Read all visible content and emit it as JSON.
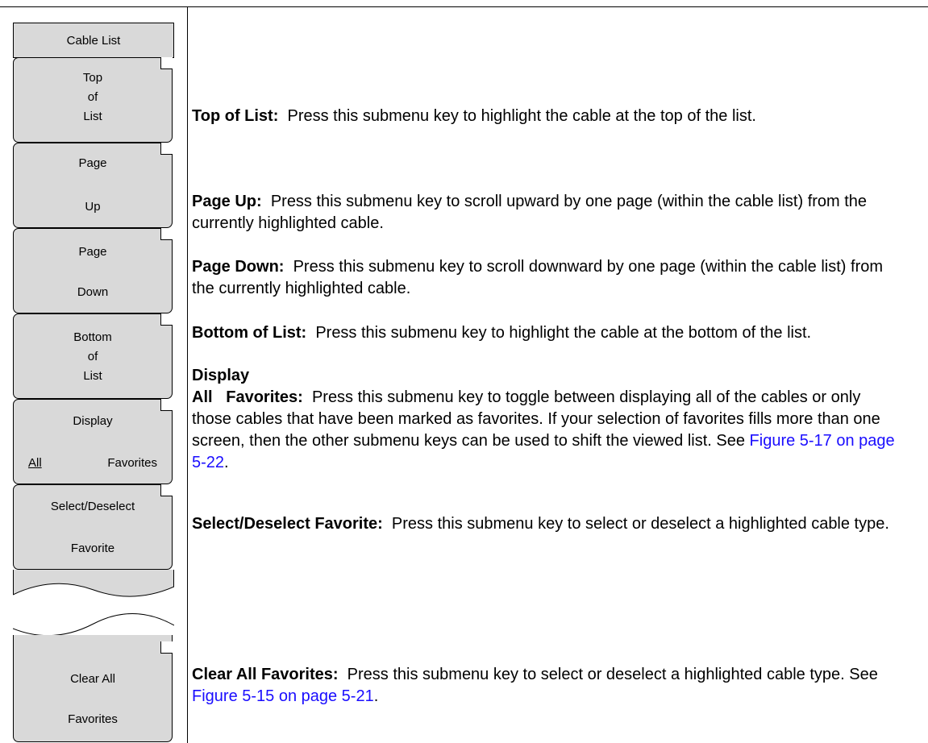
{
  "menu": {
    "title": "Cable List",
    "keys": [
      {
        "line1": "Top",
        "line2": "of",
        "line3": "List"
      },
      {
        "line1": "Page",
        "line3": "Up"
      },
      {
        "line1": "Page",
        "line3": "Down"
      },
      {
        "line1": "Bottom",
        "line2": "of",
        "line3": "List"
      },
      {
        "line1": "Display",
        "toggle_option1": "All",
        "toggle_option2": "Favorites"
      },
      {
        "line1": "Select/Deselect",
        "line3": "Favorite"
      },
      {
        "line1": "Clear All",
        "line3": "Favorites"
      }
    ]
  },
  "descriptions": {
    "top_of_list": {
      "term": "Top of List:",
      "text": "Press this submenu key to highlight the cable at the top of the list."
    },
    "page_up": {
      "term": "Page Up:",
      "text": "Press this submenu key to scroll upward by one page (within the cable list) from the currently highlighted cable."
    },
    "page_down": {
      "term": "Page Down:",
      "text": "Press this submenu key to scroll downward by one page (within the cable list) from the currently highlighted cable."
    },
    "bottom_of_list": {
      "term": "Bottom of List:",
      "text": "Press this submenu key to highlight the cable at the bottom of the list."
    },
    "display": {
      "heading": "Display",
      "term": "All   Favorites:",
      "text": "Press this submenu key to toggle between displaying all of the cables or only those cables that have been marked as favorites. If your selection of favorites fills more than one screen, then the other submenu keys can be used to shift the viewed list. See",
      "link": "Figure 5-17 on page 5-22",
      "after": "."
    },
    "select_deselect": {
      "term": "Select/Deselect Favorite:",
      "text": "Press this submenu key to select or deselect a highlighted cable type."
    },
    "clear_all": {
      "term": "Clear All Favorites:",
      "text": "Press this submenu key to select or deselect a highlighted cable type. See",
      "link": "Figure 5-15 on page 5-21",
      "after": "."
    }
  }
}
